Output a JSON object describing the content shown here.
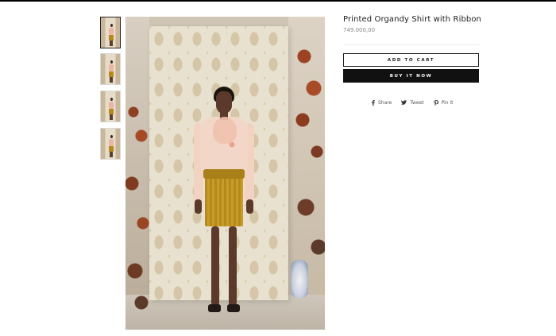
{
  "product": {
    "title": "Printed Organdy Shirt with Ribbon",
    "price": "749.000,00"
  },
  "actions": {
    "add_to_cart": "ADD TO CART",
    "buy_now": "BUY IT NOW"
  },
  "social": {
    "share": "Share",
    "tweet": "Tweet",
    "pin": "Pin it"
  },
  "gallery": {
    "thumbnail_count": 4,
    "active_thumbnail": 1
  },
  "icons": {
    "share": "facebook-icon",
    "tweet": "twitter-icon",
    "pin": "pinterest-icon"
  },
  "colors": {
    "primary_button": "#111111",
    "primary_button_text": "#ffffff",
    "secondary_button_border": "#1c1c1c",
    "price_text": "#8a8a8a"
  }
}
